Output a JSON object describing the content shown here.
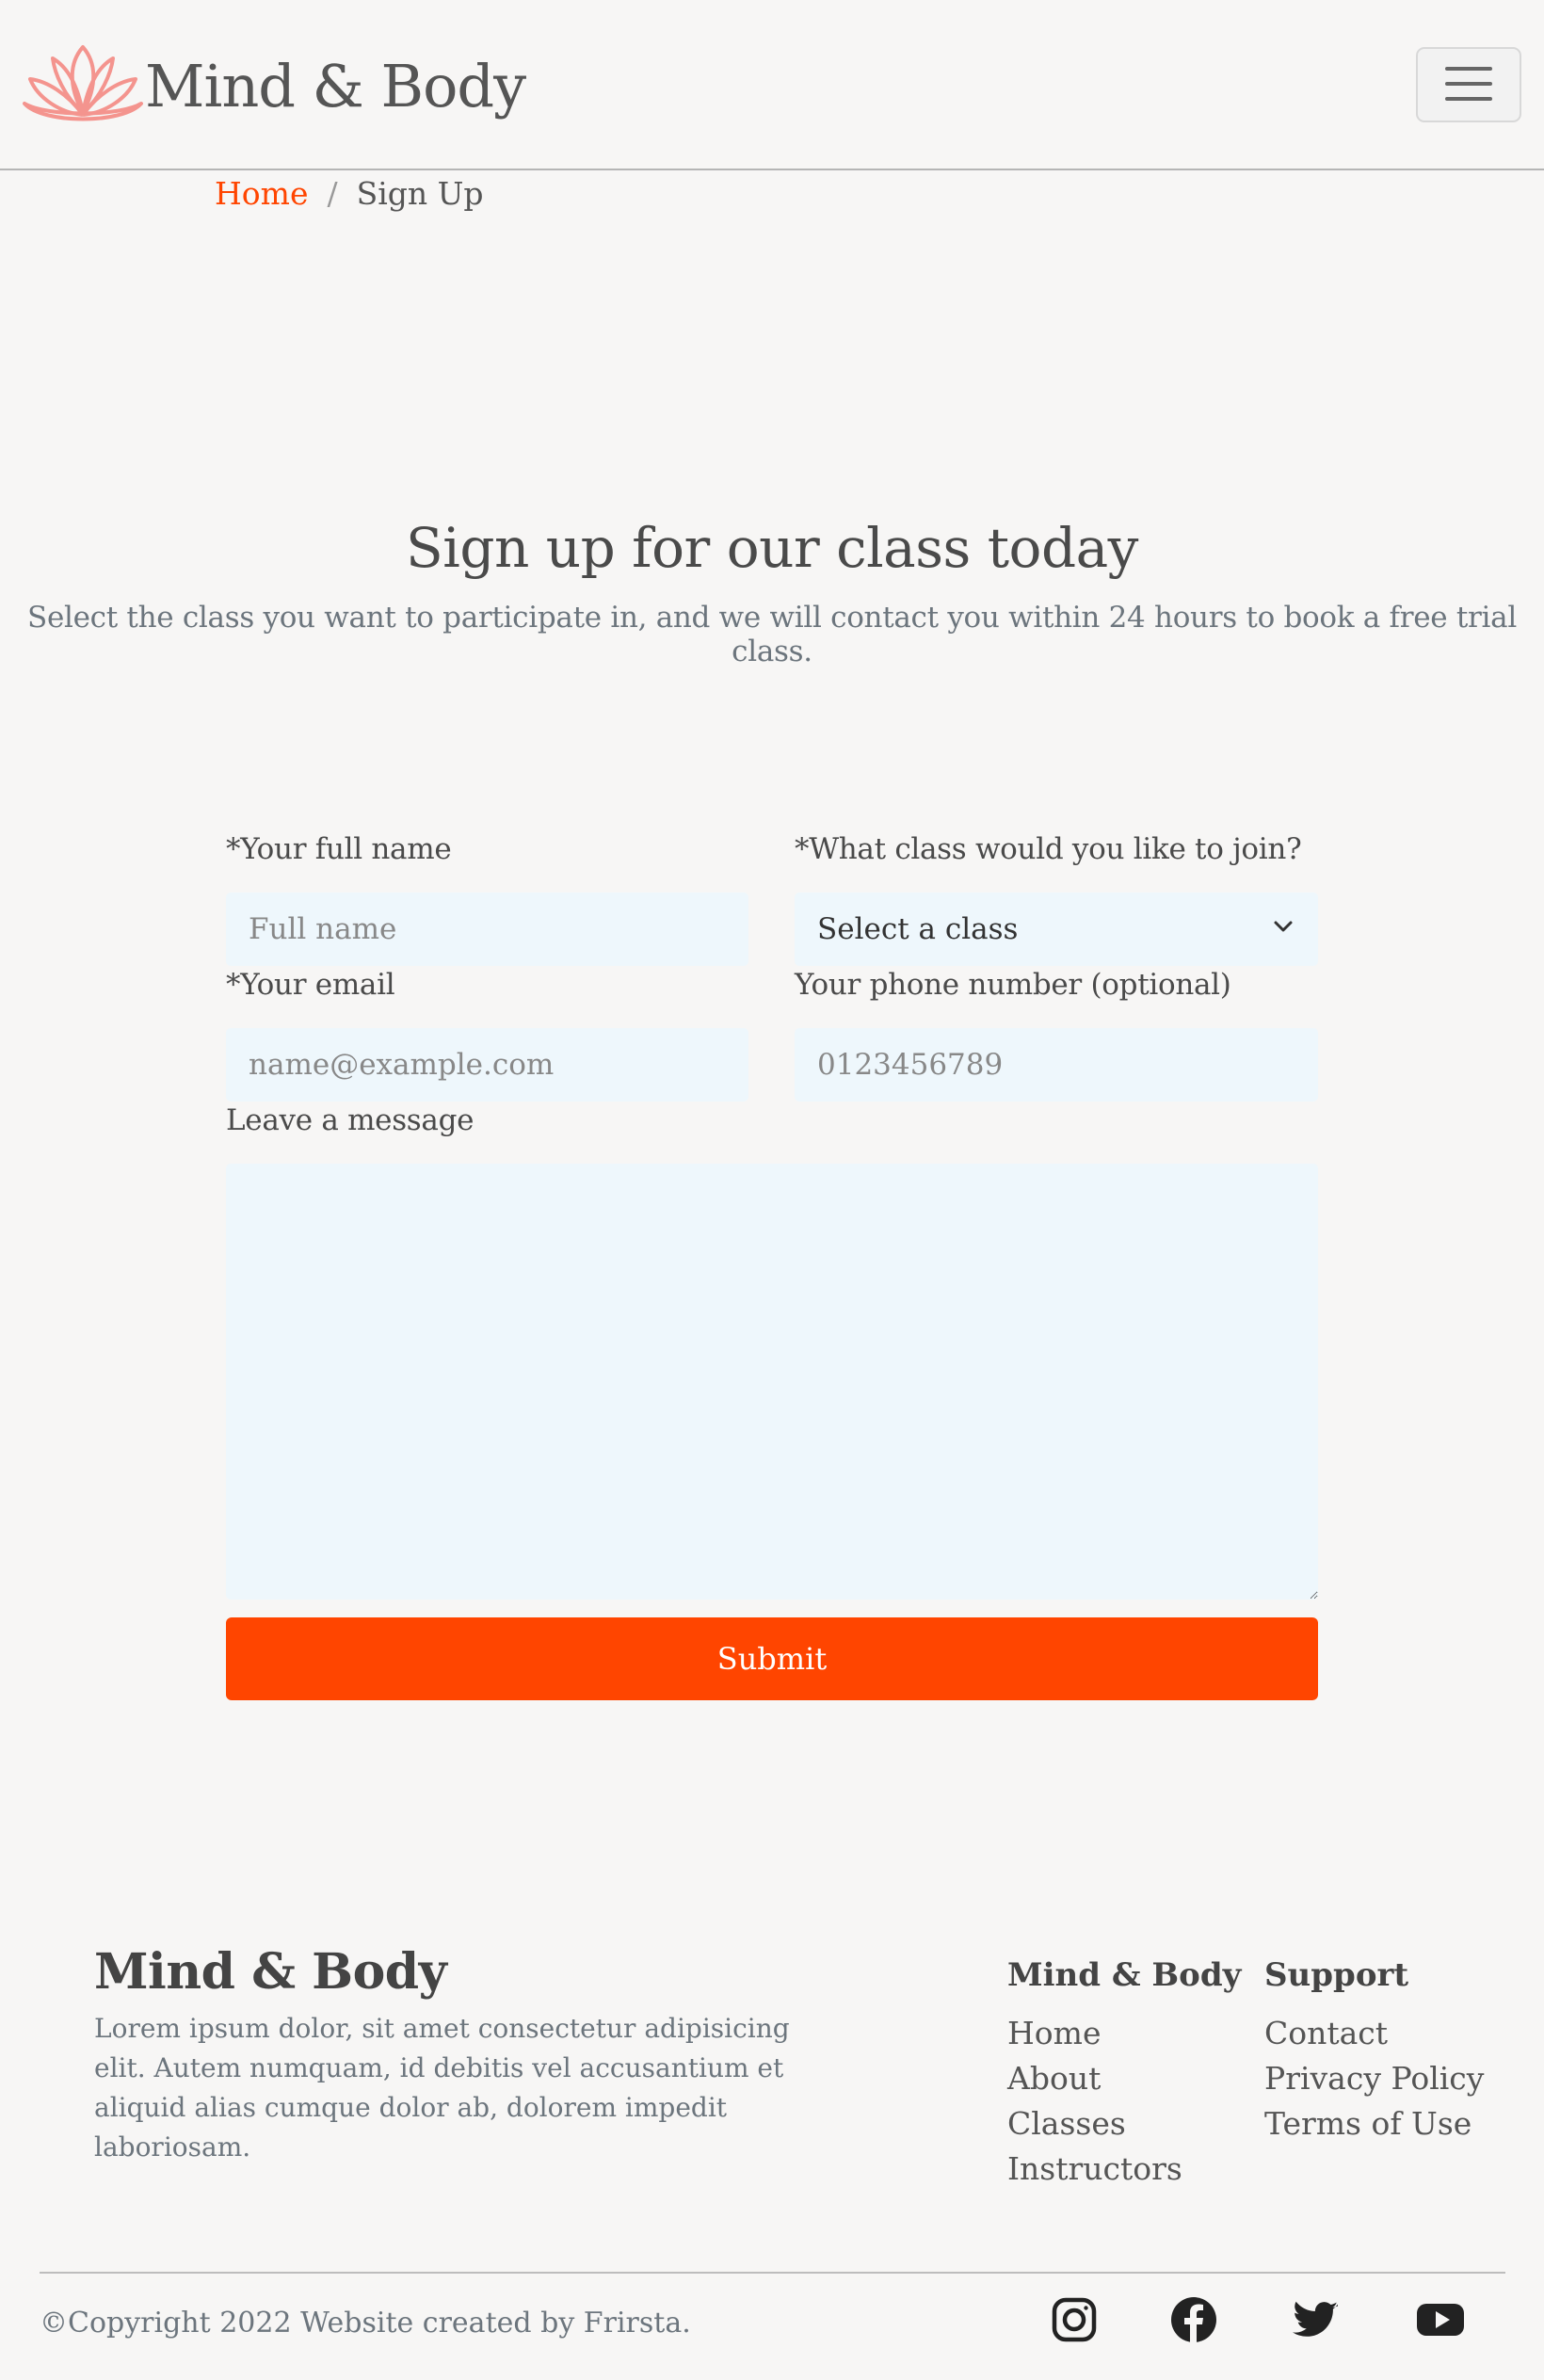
{
  "header": {
    "brand": "Mind & Body",
    "brand_color": "#f4948e",
    "menu_icon": "hamburger-icon"
  },
  "breadcrumb": {
    "home": "Home",
    "separator": "/",
    "current": "Sign Up",
    "accent": "#ff4500"
  },
  "hero": {
    "title": "Sign up for our class today",
    "subtitle": "Select the class you want to participate in, and we will contact you within 24 hours to book a free trial class."
  },
  "form": {
    "name_label": "*Your full name",
    "name_placeholder": "Full name",
    "class_label": "*What class would you like to join?",
    "class_selected": "Select a class",
    "email_label": "*Your email",
    "email_placeholder": "name@example.com",
    "phone_label": "Your phone number (optional)",
    "phone_placeholder": "0123456789",
    "message_label": "Leave a message",
    "submit_label": "Submit",
    "field_bg": "#eef7fc"
  },
  "footer": {
    "brand": "Mind & Body",
    "description": "Lorem ipsum dolor, sit amet consectetur adipisicing elit. Autem numquam, id debitis vel accusantium et aliquid alias cumque dolor ab, dolorem impedit laboriosam.",
    "col1": {
      "title": "Mind & Body",
      "links": [
        "Home",
        "About",
        "Classes",
        "Instructors"
      ]
    },
    "col2": {
      "title": "Support",
      "links": [
        "Contact",
        "Privacy Policy",
        "Terms of Use"
      ]
    },
    "copyright": "©Copyright 2022 Website created by Frirsta.",
    "social": [
      "instagram-icon",
      "facebook-icon",
      "twitter-icon",
      "youtube-icon"
    ]
  }
}
